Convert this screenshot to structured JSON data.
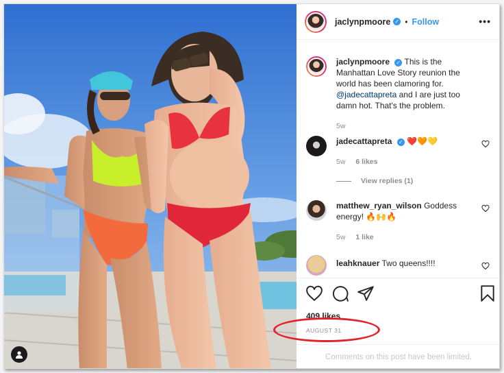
{
  "post": {
    "author": "jaclynpmoore",
    "follow_label": "Follow",
    "separator": "•",
    "verified_glyph": "✓",
    "more_glyph": "•••",
    "caption": {
      "username": "jaclynpmoore",
      "text_before": "This is the Manhattan Love Story reunion the world has been clamoring for.",
      "mention": "@jadecattapreta",
      "text_after": "and I are just too damn hot. That's the problem.",
      "time": "5w"
    },
    "comments": [
      {
        "username": "jadecattapreta",
        "verified": true,
        "text": "❤️🧡💛",
        "time": "5w",
        "likes": "6 likes"
      },
      {
        "username": "matthew_ryan_wilson",
        "verified": false,
        "text": "Goddess energy! 🔥🙌🔥",
        "time": "5w",
        "likes": "1 like"
      },
      {
        "username": "leahknauer",
        "verified": false,
        "text": "Two queens!!!!",
        "time": "",
        "likes": ""
      }
    ],
    "view_replies": "View replies (1)",
    "likes_count": "409 likes",
    "date": "AUGUST 31",
    "comments_limited": "Comments on this post have been limited."
  },
  "icons": {
    "like": "heart-icon",
    "comment": "comment-icon",
    "share": "paper-plane-icon",
    "save": "bookmark-icon",
    "user_tag": "person-icon",
    "more": "ellipsis-icon"
  },
  "colors": {
    "link_blue": "#3897f0",
    "verified_blue": "#3897f0",
    "annotation_red": "#e3212b",
    "muted_gray": "#8e8e8e"
  }
}
